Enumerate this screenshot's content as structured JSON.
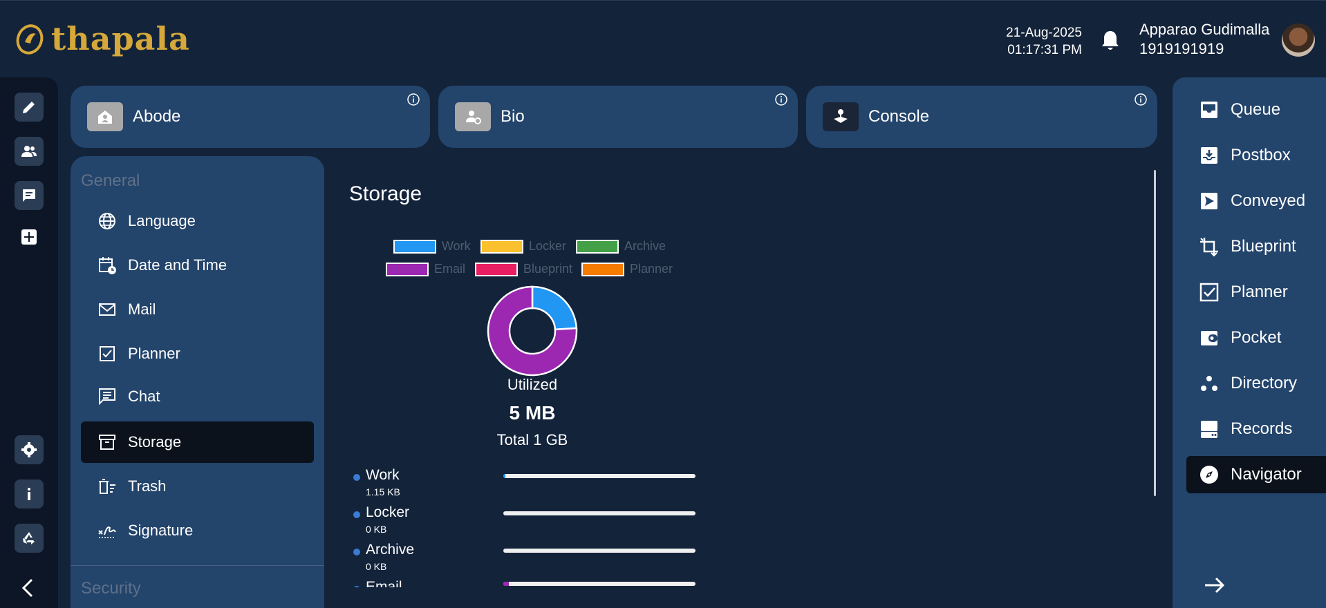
{
  "brand": {
    "name": "thapala",
    "color": "#d6a83a"
  },
  "header": {
    "date": "21-Aug-2025",
    "time": "01:17:31 PM",
    "user_name": "Apparao Gudimalla",
    "user_phone": "1919191919"
  },
  "rail": {
    "icons": [
      "pencil-icon",
      "users-icon",
      "chat-icon",
      "plus-icon",
      "gear-icon",
      "info-icon",
      "recycle-icon",
      "chevron-left-icon"
    ]
  },
  "cards": [
    {
      "label": "Abode",
      "icon": "home-icon"
    },
    {
      "label": "Bio",
      "icon": "user-gear-icon"
    },
    {
      "label": "Console",
      "icon": "joystick-icon"
    }
  ],
  "menu": {
    "general_heading": "General",
    "security_heading": "Security",
    "items": [
      {
        "label": "Language",
        "icon": "globe-icon"
      },
      {
        "label": "Date and Time",
        "icon": "calendar-clock-icon"
      },
      {
        "label": "Mail",
        "icon": "mail-icon"
      },
      {
        "label": "Planner",
        "icon": "checkbox-icon"
      },
      {
        "label": "Chat",
        "icon": "message-icon"
      },
      {
        "label": "Storage",
        "icon": "archive-icon",
        "active": true
      },
      {
        "label": "Trash",
        "icon": "trash-icon"
      },
      {
        "label": "Signature",
        "icon": "signature-icon"
      }
    ]
  },
  "storage": {
    "title": "Storage",
    "legend": [
      {
        "label": "Work",
        "color": "#2196f3"
      },
      {
        "label": "Locker",
        "color": "#fbc02d"
      },
      {
        "label": "Archive",
        "color": "#43a047"
      },
      {
        "label": "Email",
        "color": "#9c27b0"
      },
      {
        "label": "Blueprint",
        "color": "#e91e63"
      },
      {
        "label": "Planner",
        "color": "#f57c00"
      }
    ],
    "utilized_label": "Utilized",
    "utilized_value": "5 MB",
    "total_label": "Total 1 GB",
    "rows": [
      {
        "name": "Work",
        "size": "1.15 KB",
        "fill": 0.01,
        "color": "#2196f3"
      },
      {
        "name": "Locker",
        "size": "0 KB",
        "fill": 0,
        "color": "#fbc02d"
      },
      {
        "name": "Archive",
        "size": "0 KB",
        "fill": 0,
        "color": "#43a047"
      },
      {
        "name": "Email",
        "size": "",
        "fill": 0.03,
        "color": "#9c27b0"
      }
    ]
  },
  "chart_data": {
    "type": "pie",
    "categories": [
      "Work",
      "Locker",
      "Archive",
      "Email",
      "Blueprint",
      "Planner"
    ],
    "values": [
      24,
      0,
      0,
      76,
      0,
      0
    ],
    "colors": [
      "#2196f3",
      "#fbc02d",
      "#43a047",
      "#9c27b0",
      "#e91e63",
      "#f57c00"
    ],
    "legend": "top"
  },
  "rnav": {
    "items": [
      {
        "label": "Queue",
        "icon": "inbox-icon"
      },
      {
        "label": "Postbox",
        "icon": "download-box-icon"
      },
      {
        "label": "Conveyed",
        "icon": "send-icon"
      },
      {
        "label": "Blueprint",
        "icon": "crop-icon"
      },
      {
        "label": "Planner",
        "icon": "checkbox-icon"
      },
      {
        "label": "Pocket",
        "icon": "wallet-icon"
      },
      {
        "label": "Directory",
        "icon": "dots-icon"
      },
      {
        "label": "Records",
        "icon": "drive-icon"
      },
      {
        "label": "Navigator",
        "icon": "compass-icon",
        "active": true
      }
    ]
  }
}
